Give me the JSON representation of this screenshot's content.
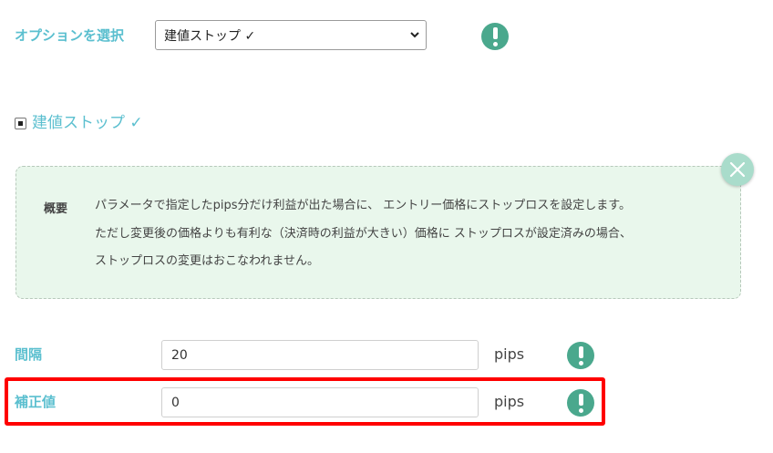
{
  "option": {
    "label": "オプションを選択",
    "selected": "建値ストップ ✓"
  },
  "checkbox": {
    "label": "建値ストップ ✓"
  },
  "info": {
    "title": "概要",
    "lines": [
      "パラメータで指定したpips分だけ利益が出た場合に、 エントリー価格にストップロスを設定します。",
      "ただし変更後の価格よりも有利な（決済時の利益が大きい）価格に ストップロスが設定済みの場合、",
      "ストップロスの変更はおこなわれません。"
    ]
  },
  "fields": {
    "interval": {
      "label": "間隔",
      "value": "20",
      "unit": "pips"
    },
    "correction": {
      "label": "補正値",
      "value": "0",
      "unit": "pips"
    }
  },
  "icons": {
    "warning": "exclamation-circle-icon",
    "close": "close-icon",
    "dropdown": "chevron-down-icon"
  },
  "colors": {
    "label": "#5bbfcf",
    "warning": "#4aa88d",
    "info_bg": "#e9f7ec",
    "close_bg": "#a9dccb",
    "highlight": "#ff0000"
  }
}
